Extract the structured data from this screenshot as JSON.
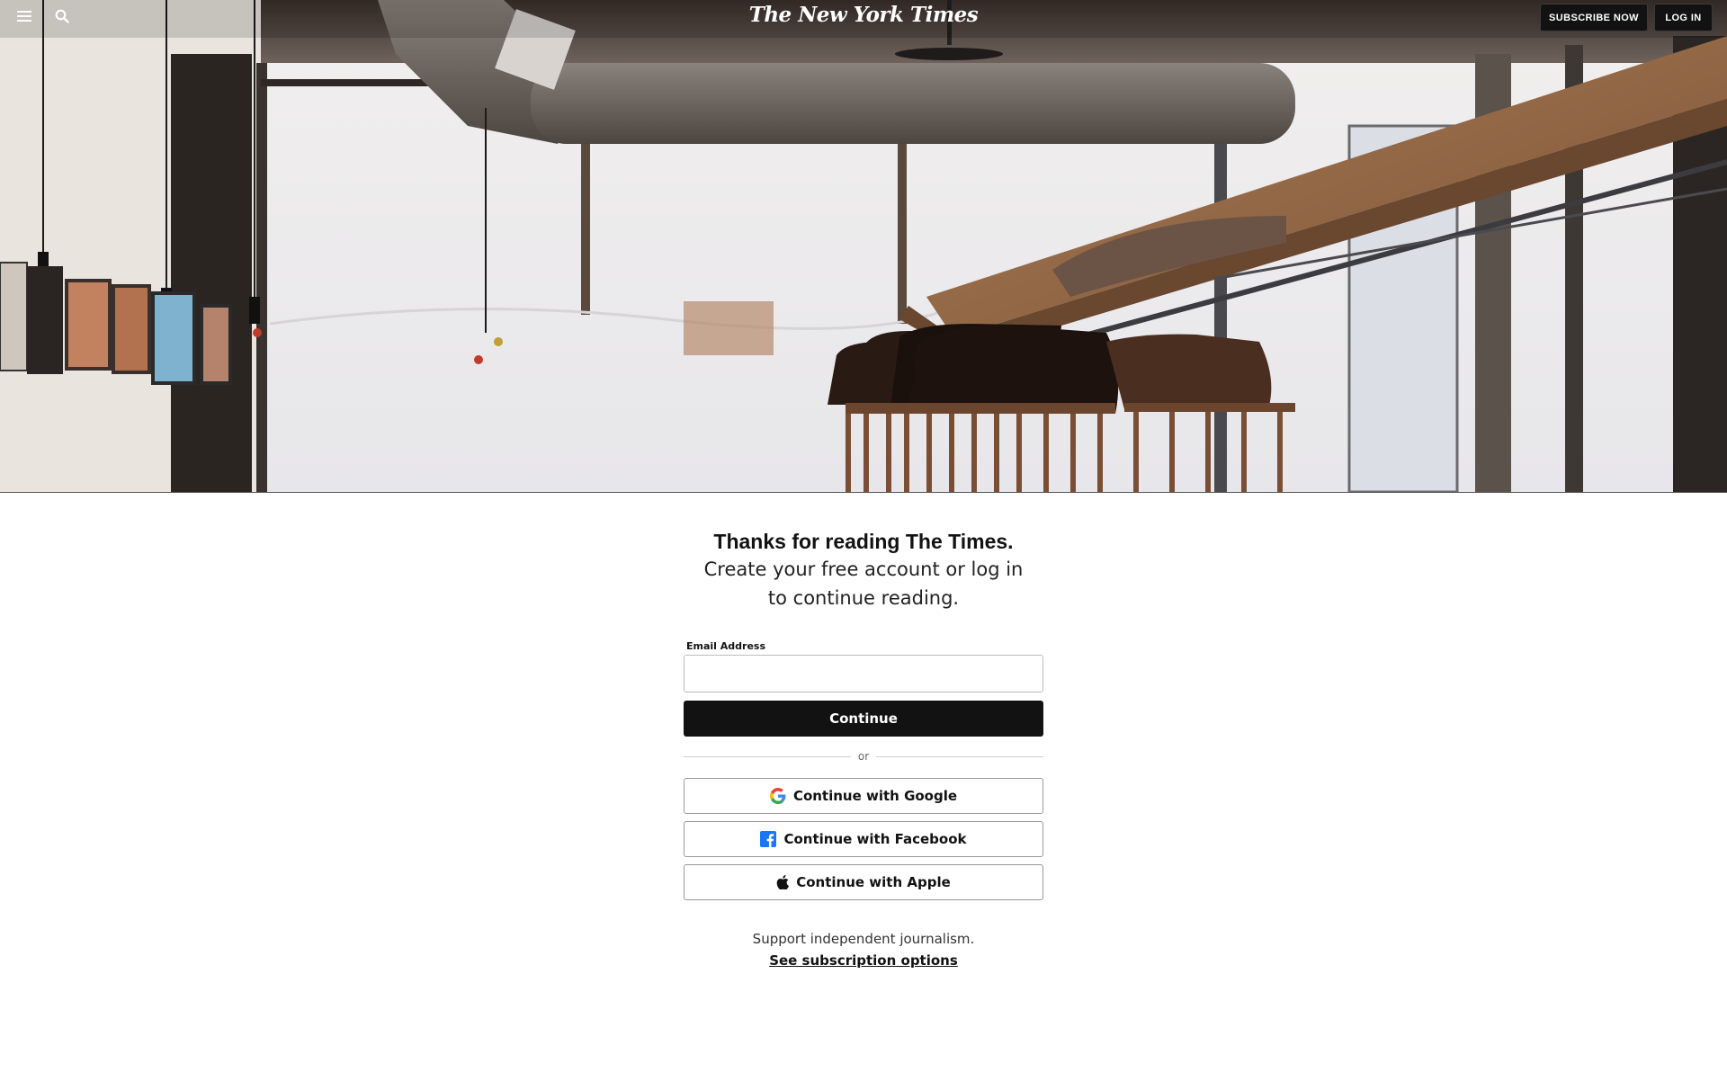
{
  "header": {
    "logo": "The New York Times",
    "subscribe_label": "SUBSCRIBE NOW",
    "login_label": "LOG IN"
  },
  "main": {
    "headline": "Thanks for reading The Times.",
    "subline": "Create your free account or log in to continue reading.",
    "email_label": "Email Address",
    "email_value": "",
    "email_placeholder": "",
    "continue_label": "Continue",
    "or_text": "or",
    "google_label": "Continue with Google",
    "facebook_label": "Continue with Facebook",
    "apple_label": "Continue with Apple",
    "support_text": "Support independent journalism.",
    "subscription_link": "See subscription options"
  },
  "icons": {
    "menu": "hamburger-menu-icon",
    "search": "search-icon",
    "google": "google-g-icon",
    "facebook": "facebook-f-icon",
    "apple": "apple-icon"
  },
  "colors": {
    "primary_button": "#121212",
    "facebook_blue": "#1877F2",
    "page_background": "#FFFFFF"
  }
}
